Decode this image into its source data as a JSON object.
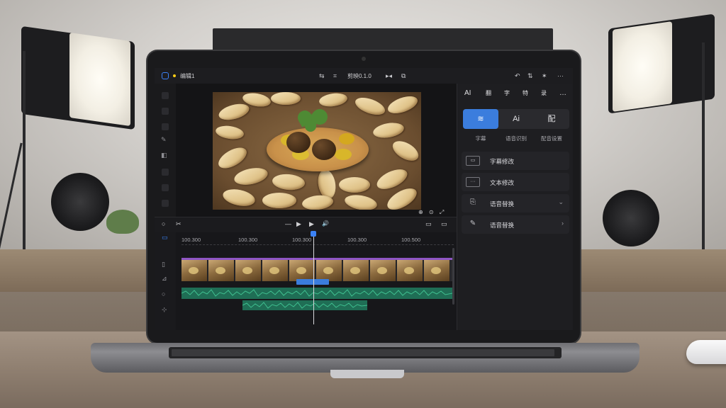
{
  "app": {
    "project_name": "编辑1",
    "tool_label": "剪映0.1.0",
    "accent": "#3b82f6"
  },
  "topbar_left_icons": [
    "editor-logo-icon",
    "unsaved-dot-icon"
  ],
  "topbar_center_icons": [
    "split-icon",
    "crop-icon",
    "ratio-icon",
    "mirror-icon"
  ],
  "topbar_right_icons": [
    "undo-icon",
    "redo-icon",
    "magic-icon",
    "more-icon"
  ],
  "right_panel": {
    "top_icons": [
      "AI",
      "翻",
      "字",
      "特",
      "录",
      "…"
    ],
    "segments": [
      {
        "label": "wifi-icon",
        "caption": "字幕",
        "active": true
      },
      {
        "label": "Ai",
        "caption": "语音识别",
        "active": false
      },
      {
        "label": "配",
        "caption": "配音设置",
        "active": false
      }
    ],
    "items": [
      {
        "icon": "▭",
        "label": "字幕修改",
        "arrow": ""
      },
      {
        "icon": "···",
        "label": "文本修改",
        "arrow": ""
      },
      {
        "icon": "⎘",
        "label": "语音替换",
        "arrow": "⌄"
      },
      {
        "icon": "✎",
        "label": "语音替换",
        "arrow": "›"
      }
    ]
  },
  "preview": {
    "tools": "⊕ ⊙ ⤢"
  },
  "transport": {
    "left": [
      "○",
      "✂"
    ],
    "center": [
      "—",
      "▶",
      "▶",
      "🔊"
    ],
    "right": [
      "▭",
      "▭"
    ]
  },
  "timeline": {
    "ruler_labels": [
      "100.300",
      "100.300",
      "100.300",
      "100.300",
      "100.500"
    ],
    "clip_colors": {
      "video": "#8e55c4",
      "text": "#3b7ddd",
      "audio": "#1f6e55"
    }
  }
}
